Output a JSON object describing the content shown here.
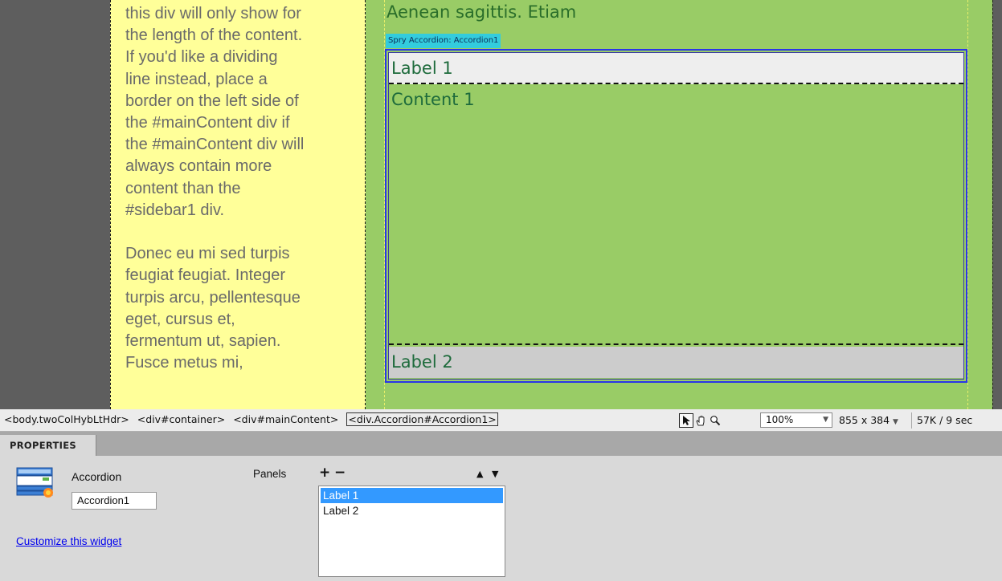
{
  "sidebar": {
    "text": "this div will only show for\nthe length of the content.\nIf you'd like a dividing\nline instead, place a\nborder on the left side of\nthe #mainContent div if\nthe #mainContent div will\nalways contain more\ncontent than the\n#sidebar1 div.\n\nDonec eu mi sed turpis\nfeugiat feugiat. Integer\nturpis arcu, pellentesque\neget, cursus et,\nfermentum ut, sapien.\nFusce metus mi,"
  },
  "main": {
    "heading": "Aenean sagittis. Etiam",
    "spry_tag": "Spry Accordion: Accordion1",
    "accordion": {
      "label1": "Label 1",
      "content1": "Content 1",
      "label2": "Label 2"
    }
  },
  "tagbar": {
    "path": [
      "<body.twoColHybLtHdr>",
      "<div#container>",
      "<div#mainContent>",
      "<div.Accordion#Accordion1>"
    ],
    "selected_index": 3,
    "tools": [
      "select-pointer-icon",
      "hand-icon",
      "zoom-icon"
    ],
    "zoom": "100%",
    "window_size": "855 x 384",
    "doc_size": "57K / 9 sec"
  },
  "properties": {
    "tab_label": "PROPERTIES",
    "widget_type": "Accordion",
    "widget_id": "Accordion1",
    "customize_link": "Customize this widget",
    "panels_label": "Panels",
    "add_symbol": "+",
    "remove_symbol": "−",
    "up_symbol": "▲",
    "down_symbol": "▼",
    "panels": [
      "Label 1",
      "Label 2"
    ],
    "selected_panel": "Label 1"
  },
  "colors": {
    "sidebar_bg": "#ffff99",
    "main_bg": "#99cc66",
    "accordion_border": "#2a35e8",
    "spry_tag_bg": "#33ccdd",
    "selected_list_bg": "#3399ff"
  }
}
